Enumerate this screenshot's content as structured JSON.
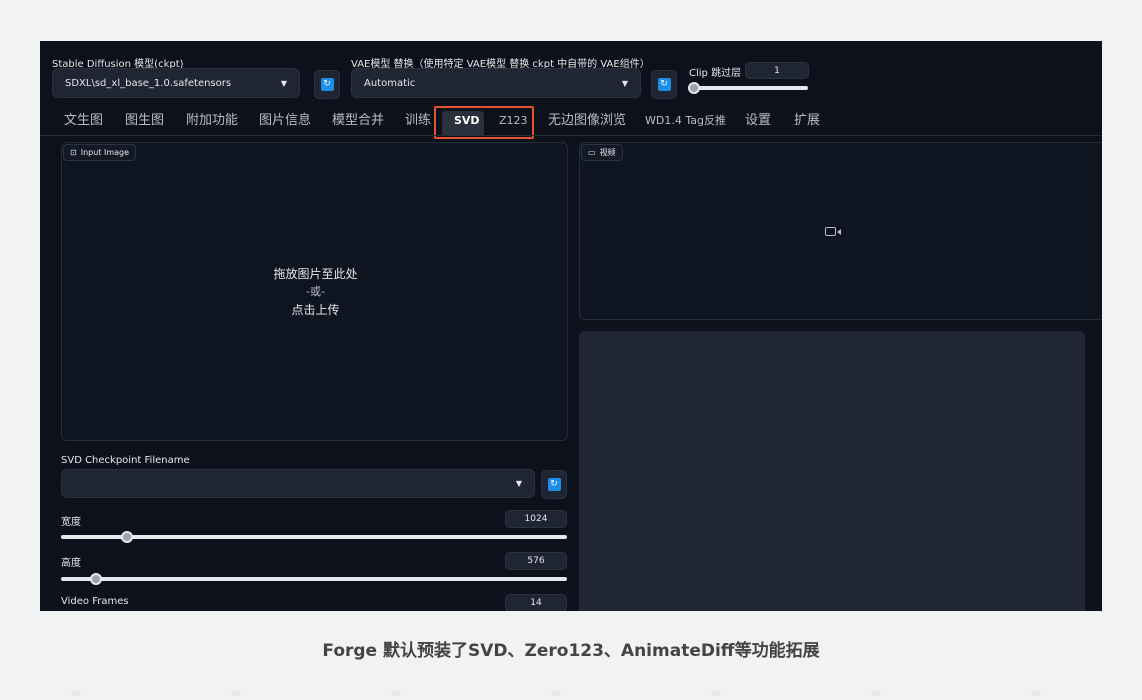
{
  "top": {
    "ckpt_label": "Stable Diffusion 模型(ckpt)",
    "ckpt_value": "SDXL\\sd_xl_base_1.0.safetensors",
    "vae_label": "VAE模型 替换（使用特定 VAE模型 替换 ckpt 中自带的 VAE组件）",
    "vae_value": "Automatic",
    "clip_label": "Clip 跳过层",
    "clip_value": "1"
  },
  "tabs": [
    "文生图",
    "图生图",
    "附加功能",
    "图片信息",
    "模型合并",
    "训练",
    "SVD",
    "Z123",
    "无边图像浏览",
    "WD1.4 Tag反推",
    "设置",
    "扩展"
  ],
  "left": {
    "input_chip": "Input Image",
    "drop_line1": "拖放图片至此处",
    "drop_or": "-或-",
    "drop_line2": "点击上传",
    "svd_ckpt_label": "SVD Checkpoint Filename",
    "svd_ckpt_value": "",
    "width_label": "宽度",
    "width_value": "1024",
    "width_fraction": 0.13,
    "height_label": "高度",
    "height_value": "576",
    "height_fraction": 0.07,
    "frames_label": "Video Frames",
    "frames_value": "14"
  },
  "right": {
    "video_chip": "视频"
  },
  "caption": "Forge 默认预装了SVD、Zero123、AnimateDiff等功能拓展",
  "colors": {
    "app_bg": "#0c111b",
    "highlight": "#e5532f",
    "refresh_icon": "#1c8ee8"
  },
  "icons": {
    "refresh": "refresh-icon",
    "image": "image-icon",
    "video": "video-icon",
    "dropdown": "chevron-down-icon"
  }
}
